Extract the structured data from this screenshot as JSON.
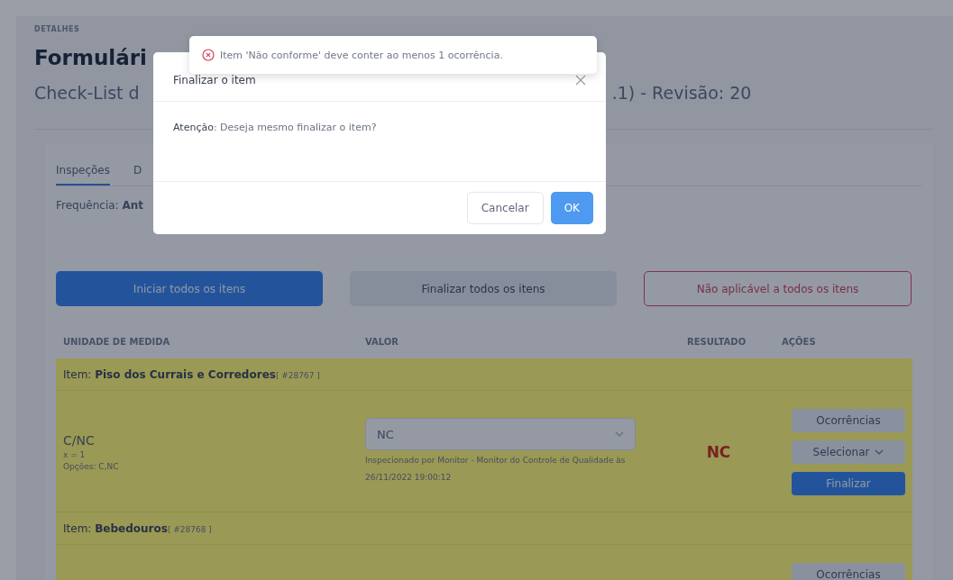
{
  "page": {
    "eyebrow": "DETALHES",
    "title_visible": "Formulári",
    "subtitle_left": "Check-List d",
    "subtitle_right": ".1) - Revisão: 20"
  },
  "tabs": [
    {
      "label": "Inspeções",
      "selected": true
    },
    {
      "label": "D",
      "selected": false
    }
  ],
  "frequency": {
    "label": "Frequência:",
    "value": "Ant"
  },
  "bulk_buttons": [
    {
      "label": "Iniciar todos os itens",
      "kind": "primary"
    },
    {
      "label": "Finalizar todos os itens",
      "kind": "secondary"
    },
    {
      "label": "Não aplicável a todos os itens",
      "kind": "danger"
    }
  ],
  "table": {
    "columns": [
      "UNIDADE DE MEDIDA",
      "VALOR",
      "RESULTADO",
      "AÇÕES"
    ],
    "items": [
      {
        "prefix": "Item:",
        "name": "Piso dos Currais e Corredores",
        "code": "[ #28767 ]",
        "unit": "C/NC",
        "formula": "x = 1",
        "options": "Opções: C,NC",
        "value": "NC",
        "inspected": "Inspecionado por Monitor - Monitor do Controle de Qualidade às 26/11/2022 19:00:12",
        "result": "NC",
        "actions": [
          {
            "label": "Ocorrências",
            "kind": "secondary"
          },
          {
            "label": "Selecionar",
            "kind": "dropdown"
          },
          {
            "label": "Finalizar",
            "kind": "primary"
          }
        ]
      },
      {
        "prefix": "Item:",
        "name": "Bebedouros",
        "code": "[ #28768 ]",
        "actions": [
          {
            "label": "Ocorrências",
            "kind": "secondary"
          }
        ]
      }
    ]
  },
  "toast": {
    "message": "Item 'Não conforme' deve conter ao menos 1 ocorrência."
  },
  "modal": {
    "title": "Finalizar o item",
    "body": "**Atenção**: Deseja mesmo finalizar o item?",
    "buttons": [
      {
        "label": "Cancelar",
        "kind": "secondary"
      },
      {
        "label": "OK",
        "kind": "primary"
      }
    ]
  }
}
